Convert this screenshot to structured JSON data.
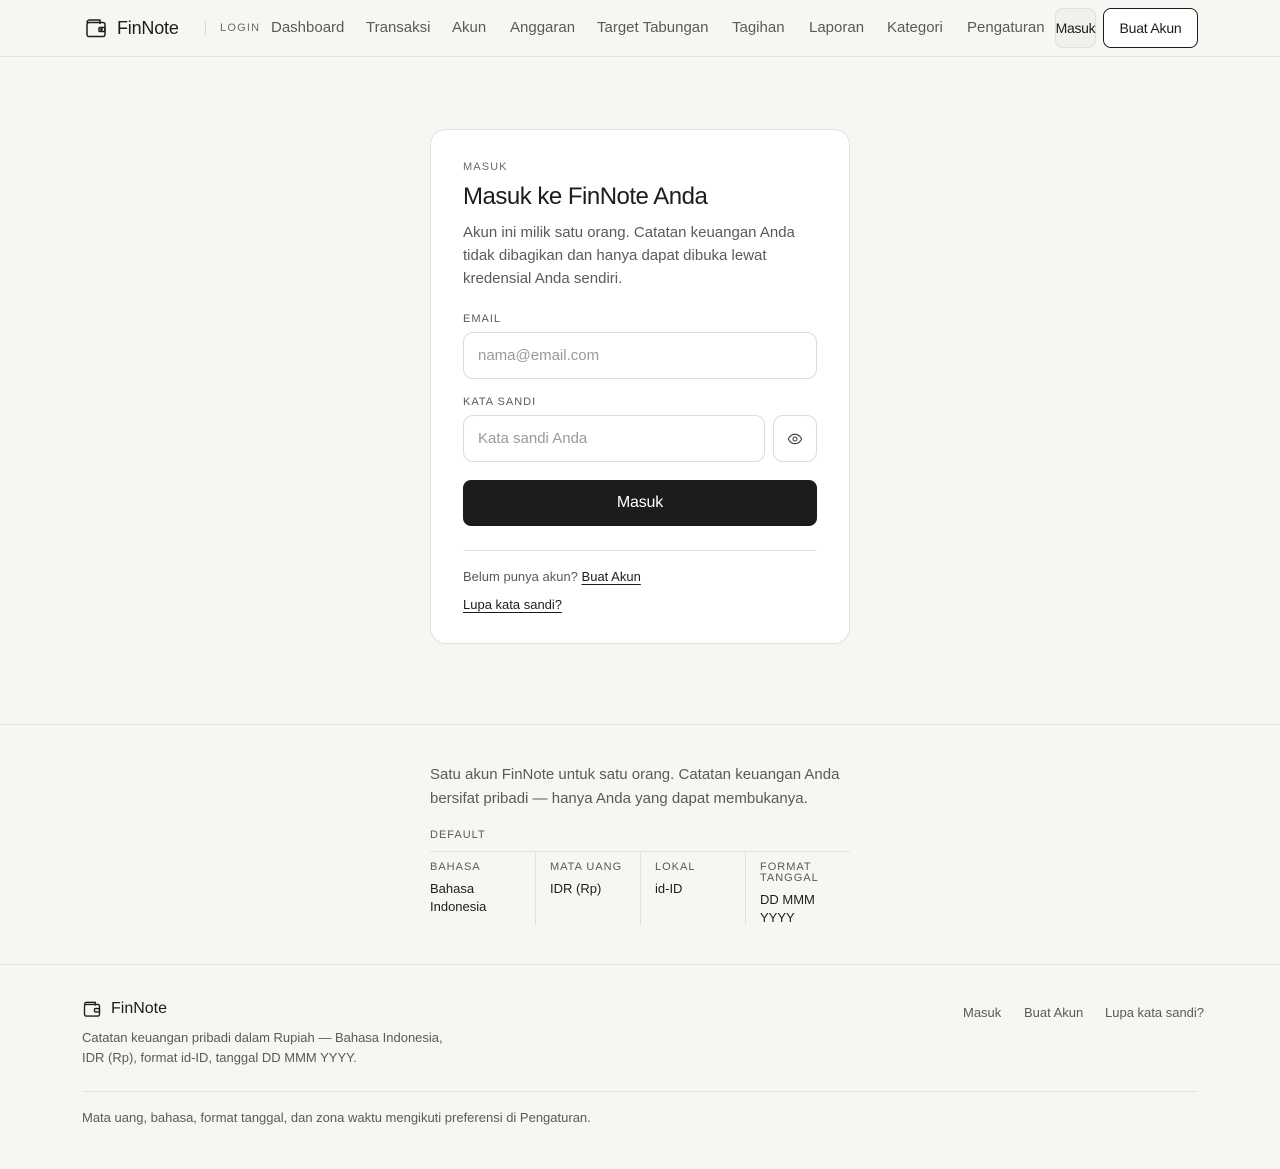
{
  "app": {
    "name": "FinNote"
  },
  "header": {
    "page_tag": "LOGIN",
    "nav": [
      "Dashboard",
      "Transaksi",
      "Akun",
      "Anggaran",
      "Target Tabungan",
      "Tagihan",
      "Laporan",
      "Kategori",
      "Pengaturan"
    ],
    "login_label": "Masuk",
    "signup_label": "Buat Akun"
  },
  "login_card": {
    "eyebrow": "MASUK",
    "title": "Masuk ke FinNote Anda",
    "description": "Akun ini milik satu orang. Catatan keuangan Anda tidak dibagikan dan hanya dapat dibuka lewat kredensial Anda sendiri.",
    "email": {
      "label": "EMAIL",
      "placeholder": "nama@email.com",
      "value": ""
    },
    "password": {
      "label": "KATA SANDI",
      "placeholder": "Kata sandi Anda",
      "value": "",
      "toggle_icon": "eye-icon"
    },
    "submit_label": "Masuk",
    "no_account_text": "Belum punya akun?",
    "signup_link": "Buat Akun",
    "forgot_link": "Lupa kata sandi?"
  },
  "info": {
    "text": "Satu akun FinNote untuk satu orang. Catatan keuangan Anda bersifat pribadi — hanya Anda yang dapat membukanya.",
    "defaults_label": "DEFAULT",
    "defaults": [
      {
        "key": "BAHASA",
        "value": "Bahasa Indonesia"
      },
      {
        "key": "MATA UANG",
        "value": "IDR (Rp)"
      },
      {
        "key": "LOKAL",
        "value": "id-ID"
      },
      {
        "key": "FORMAT TANGGAL",
        "value": "DD MMM YYYY"
      }
    ]
  },
  "footer": {
    "brand": "FinNote",
    "description": "Catatan keuangan pribadi dalam Rupiah — Bahasa Indonesia, IDR (Rp), format id-ID, tanggal DD MMM YYYY.",
    "links": [
      "Masuk",
      "Buat Akun",
      "Lupa kata sandi?"
    ],
    "note": "Mata uang, bahasa, format tanggal, dan zona waktu mengikuti preferensi di Pengaturan."
  },
  "colors": {
    "background": "#f7f6f2",
    "primary": "#1c1c1e",
    "border": "#e4e2dc",
    "muted_text": "#5a5a5a"
  }
}
